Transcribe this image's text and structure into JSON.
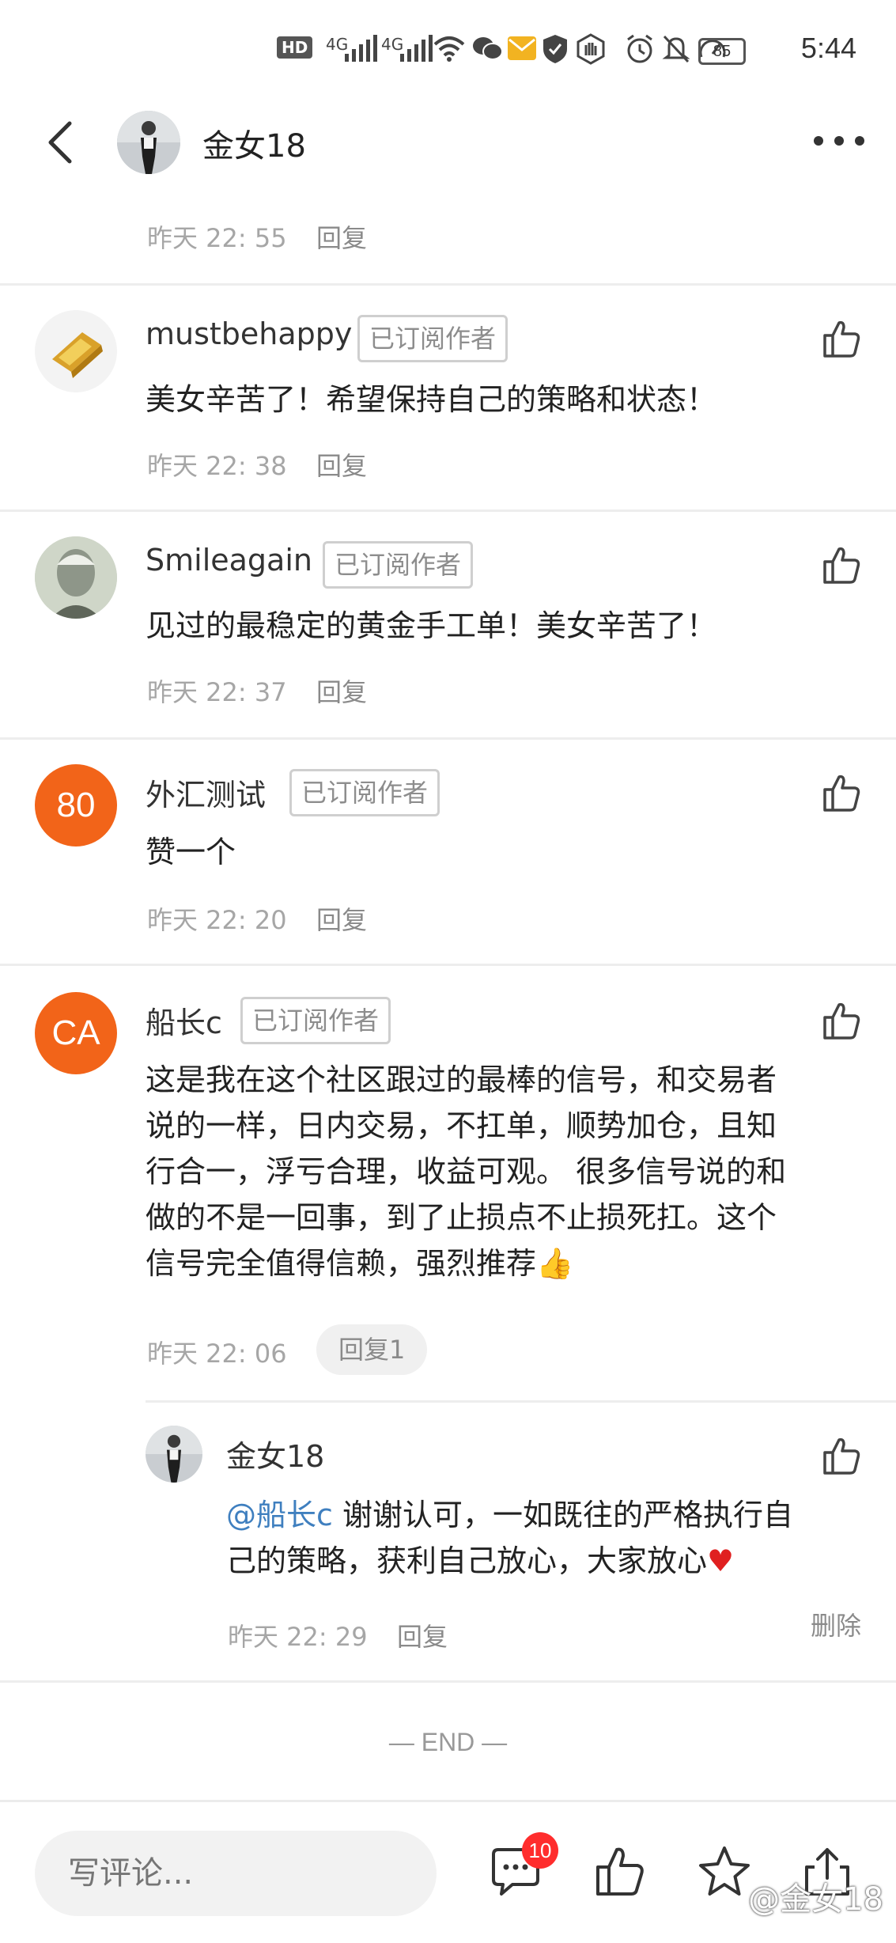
{
  "status_bar": {
    "hd_label": "HD",
    "signal1_label": "4G",
    "signal2_label": "4G",
    "battery": "85",
    "time": "5:44"
  },
  "header": {
    "title": "金女18"
  },
  "top_partial": {
    "time": "昨天 22: 55",
    "reply": "回复"
  },
  "comments": [
    {
      "name": "mustbehappy",
      "badge": "已订阅作者",
      "text": "美女辛苦了！希望保持自己的策略和状态！",
      "time": "昨天 22: 38",
      "reply": "回复"
    },
    {
      "name": "Smileagain",
      "badge": "已订阅作者",
      "text": "见过的最稳定的黄金手工单！美女辛苦了！",
      "time": "昨天 22: 37",
      "reply": "回复"
    },
    {
      "name": "外汇测试",
      "avatar_text": "80",
      "badge": "已订阅作者",
      "text": "赞一个",
      "time": "昨天 22: 20",
      "reply": "回复"
    },
    {
      "name": "船长c",
      "avatar_text": "CA",
      "badge": "已订阅作者",
      "text_lines": [
        "这是我在这个社区跟过的最棒的信号，和交易者",
        "说的一样，日内交易，不扛单，顺势加仓，且知",
        "行合一，浮亏合理，收益可观。 很多信号说的和",
        "做的不是一回事，到了止损点不止损死扛。这个",
        "信号完全值得信赖，强烈推荐"
      ],
      "emoji": "👍",
      "time": "昨天 22: 06",
      "reply": "回复1"
    }
  ],
  "sub_reply": {
    "name": "金女18",
    "mention": "@船长c",
    "text_line1": " 谢谢认可，一如既往的严格执行自",
    "text_line2": "己的策略，获利自己放心，大家放心",
    "heart": "♥",
    "time": "昨天 22: 29",
    "reply": "回复",
    "delete": "删除"
  },
  "end_label": "— END —",
  "bottom_bar": {
    "input_placeholder": "写评论...",
    "comment_count": "10",
    "watermark": "@金女18"
  },
  "colors": {
    "avatar_orange": "#f26419",
    "mention_blue": "#3f7fbf",
    "badge_red": "#ff2d2d"
  }
}
